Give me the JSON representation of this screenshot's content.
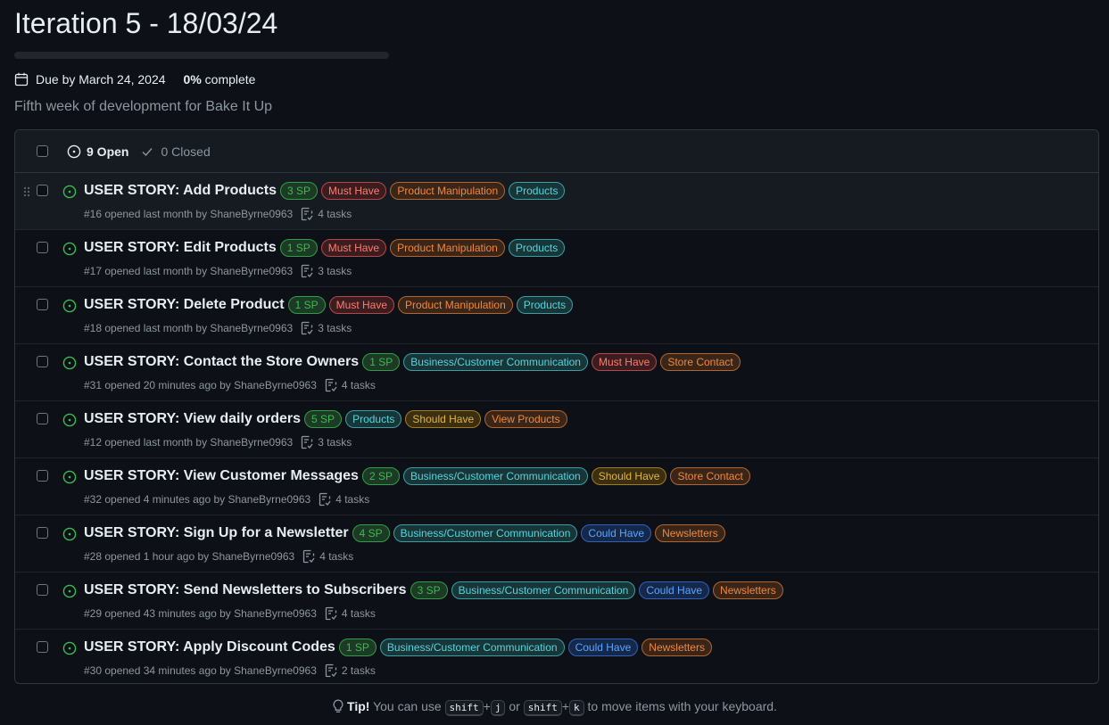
{
  "milestone": {
    "title": "Iteration 5 - 18/03/24",
    "progress_fraction": 0,
    "due": "Due by March 24, 2024",
    "percent": "0%",
    "percent_suffix": " complete",
    "description": "Fifth week of development for Bake It Up"
  },
  "list_header": {
    "open_label": "9 Open",
    "closed_label": "0 Closed"
  },
  "colors": {
    "sp": "#3fb950",
    "must": "#ff7b72",
    "product_manip": "#f0883e",
    "products": "#56d4dd",
    "business": "#56d4dd",
    "store_contact": "#f0883e",
    "should": "#d29922",
    "view_products": "#f0883e",
    "could": "#58a6ff",
    "newsletters": "#f0883e"
  },
  "issues": [
    {
      "title": "USER STORY: Add Products",
      "labels": [
        [
          "3 SP",
          "sp"
        ],
        [
          "Must Have",
          "must"
        ],
        [
          "Product Manipulation",
          "pm"
        ],
        [
          "Products",
          "prod"
        ]
      ],
      "meta": "#16 opened last month by ShaneByrne0963",
      "tasks": "4 tasks"
    },
    {
      "title": "USER STORY: Edit Products",
      "labels": [
        [
          "1 SP",
          "sp"
        ],
        [
          "Must Have",
          "must"
        ],
        [
          "Product Manipulation",
          "pm"
        ],
        [
          "Products",
          "prod"
        ]
      ],
      "meta": "#17 opened last month by ShaneByrne0963",
      "tasks": "3 tasks"
    },
    {
      "title": "USER STORY: Delete Product",
      "labels": [
        [
          "1 SP",
          "sp"
        ],
        [
          "Must Have",
          "must"
        ],
        [
          "Product Manipulation",
          "pm"
        ],
        [
          "Products",
          "prod"
        ]
      ],
      "meta": "#18 opened last month by ShaneByrne0963",
      "tasks": "3 tasks"
    },
    {
      "title": "USER STORY: Contact the Store Owners",
      "labels": [
        [
          "1 SP",
          "sp"
        ],
        [
          "Business/Customer Communication",
          "biz"
        ],
        [
          "Must Have",
          "must"
        ],
        [
          "Store Contact",
          "store"
        ]
      ],
      "meta": "#31 opened 20 minutes ago by ShaneByrne0963",
      "tasks": "4 tasks"
    },
    {
      "title": "USER STORY: View daily orders",
      "labels": [
        [
          "5 SP",
          "sp"
        ],
        [
          "Products",
          "prod"
        ],
        [
          "Should Have",
          "should"
        ],
        [
          "View Products",
          "view"
        ]
      ],
      "meta": "#12 opened last month by ShaneByrne0963",
      "tasks": "3 tasks"
    },
    {
      "title": "USER STORY: View Customer Messages",
      "labels": [
        [
          "2 SP",
          "sp"
        ],
        [
          "Business/Customer Communication",
          "biz"
        ],
        [
          "Should Have",
          "should"
        ],
        [
          "Store Contact",
          "store"
        ]
      ],
      "meta": "#32 opened 4 minutes ago by ShaneByrne0963",
      "tasks": "4 tasks"
    },
    {
      "title": "USER STORY: Sign Up for a Newsletter",
      "labels": [
        [
          "4 SP",
          "sp"
        ],
        [
          "Business/Customer Communication",
          "biz"
        ],
        [
          "Could Have",
          "could"
        ],
        [
          "Newsletters",
          "news"
        ]
      ],
      "meta": "#28 opened 1 hour ago by ShaneByrne0963",
      "tasks": "4 tasks"
    },
    {
      "title": "USER STORY: Send Newsletters to Subscribers",
      "labels": [
        [
          "3 SP",
          "sp"
        ],
        [
          "Business/Customer Communication",
          "biz"
        ],
        [
          "Could Have",
          "could"
        ],
        [
          "Newsletters",
          "news"
        ]
      ],
      "meta": "#29 opened 43 minutes ago by ShaneByrne0963",
      "tasks": "4 tasks"
    },
    {
      "title": "USER STORY: Apply Discount Codes",
      "labels": [
        [
          "1 SP",
          "sp"
        ],
        [
          "Business/Customer Communication",
          "biz"
        ],
        [
          "Could Have",
          "could"
        ],
        [
          "Newsletters",
          "news"
        ]
      ],
      "meta": "#30 opened 34 minutes ago by ShaneByrne0963",
      "tasks": "2 tasks"
    }
  ],
  "tip": {
    "bold": "Tip!",
    "text1": " You can use ",
    "key1": "shift",
    "plus": "+",
    "key2": "j",
    "or": " or ",
    "key3": "shift",
    "key4": "k",
    "text2": " to move items with your keyboard."
  }
}
